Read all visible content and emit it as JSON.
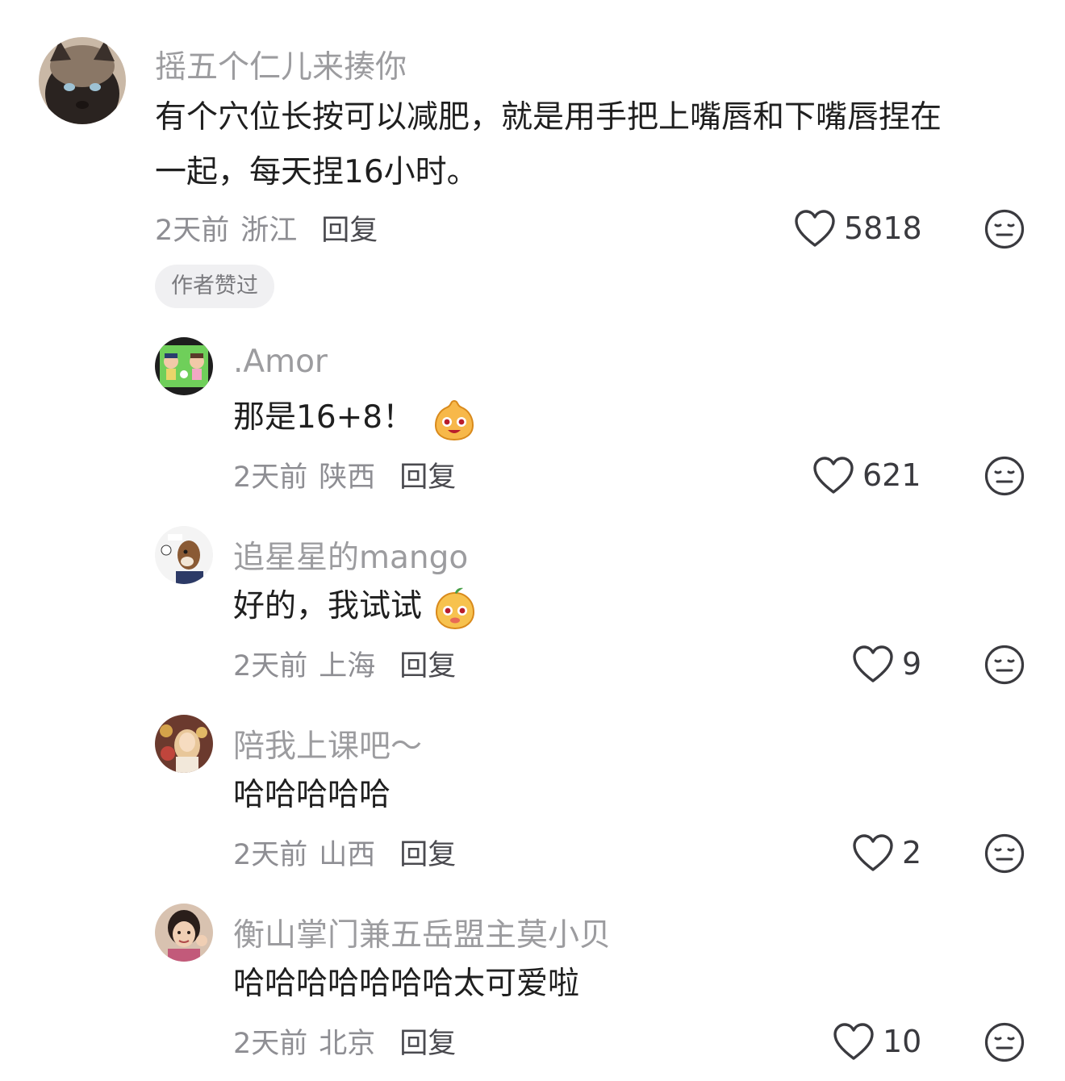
{
  "comments": [
    {
      "username": "摇五个仁儿来揍你",
      "text_line1": "有个穴位长按可以减肥，就是用手把上嘴唇和下嘴唇捏在",
      "text_line2": "一起，每天捏16小时。",
      "time": "2天前",
      "location": "浙江",
      "reply_label": "回复",
      "likes": "5818",
      "badge": "作者赞过"
    },
    {
      "username": ".Amor",
      "text": "那是16+8！",
      "emoji": "smiling-face-emoji",
      "time": "2天前",
      "location": "陕西",
      "reply_label": "回复",
      "likes": "621"
    },
    {
      "username": "追星星的mango",
      "text": "好的，我试试",
      "emoji": "smiling-face-emoji",
      "time": "2天前",
      "location": "上海",
      "reply_label": "回复",
      "likes": "9"
    },
    {
      "username": "陪我上课吧～",
      "text": "哈哈哈哈哈",
      "time": "2天前",
      "location": "山西",
      "reply_label": "回复",
      "likes": "2"
    },
    {
      "username": "衡山掌门兼五岳盟主莫小贝",
      "text": "哈哈哈哈哈哈哈太可爱啦",
      "time": "2天前",
      "location": "北京",
      "reply_label": "回复",
      "likes": "10"
    }
  ],
  "icons": {
    "like": "heart-outline-icon",
    "dislike": "meh-face-icon"
  },
  "colors": {
    "username": "#9c9c9f",
    "text": "#1f1f1f",
    "meta": "#8e8e93",
    "badge_bg": "#f0f0f2"
  }
}
